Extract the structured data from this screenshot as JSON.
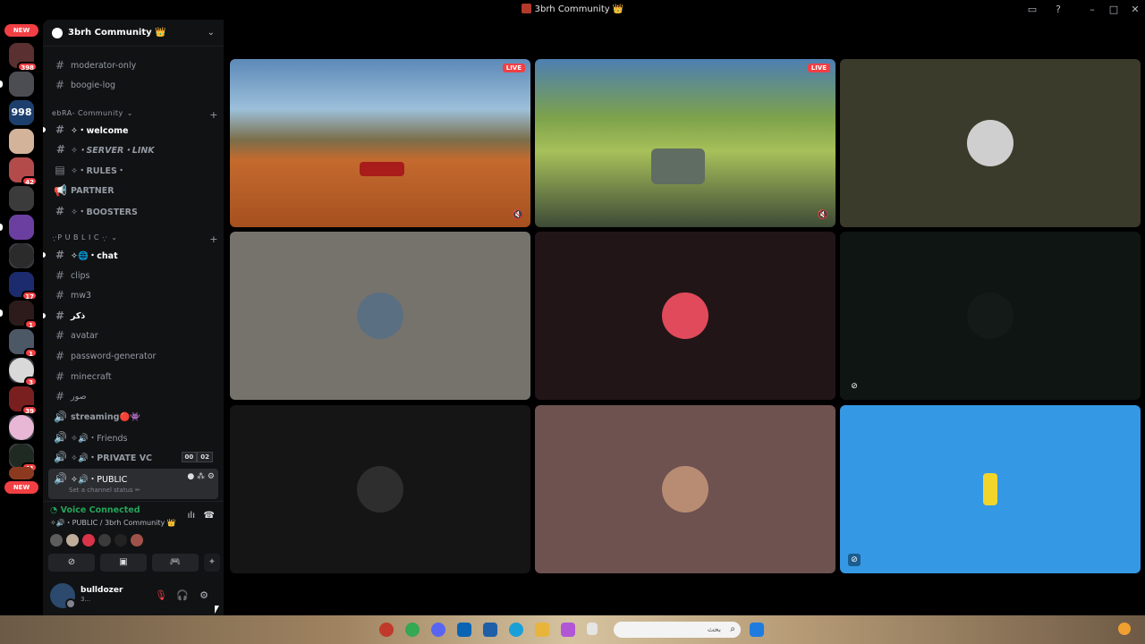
{
  "window": {
    "title": "3brh Community 👑"
  },
  "rail": {
    "new_top": "NEW",
    "new_bottom": "NEW",
    "badges": [
      "398",
      "998",
      "42",
      "17",
      "1",
      "1",
      "3",
      "39",
      "41"
    ]
  },
  "server": {
    "name": "3brh Community 👑"
  },
  "channels": {
    "moderator_only": "moderator-only",
    "boogie_log": "boogie-log",
    "category1": "ebRA- Community",
    "welcome": "✧・welcome",
    "server_link": "✧・SERVER・LINK",
    "rules": "✧・RULES・",
    "partner": "PARTNER",
    "boosters": "✧・BOOSTERS",
    "category2": "·͙·P U B L I C ·͙·",
    "chat": "✧🌐・chat",
    "clips": "clips",
    "mw3": "mw3",
    "dhikr": "ذكر",
    "avatar": "avatar",
    "password_generator": "password-generator",
    "minecraft": "minecraft",
    "suwar": "صور",
    "streaming": "streaming🔴👾",
    "friends": "✧🔊・Friends",
    "private_vc": "✧🔊・PRIVATE VC",
    "private_vc_count_a": "00",
    "private_vc_count_b": "02",
    "public": "✧🔊・PUBLIC",
    "public_status": "Set a channel status ✏"
  },
  "voice": {
    "status": "Voice Connected",
    "location": "✧🔊・PUBLIC / 3brh Community 👑"
  },
  "user": {
    "name": "bulldozer",
    "status": "3..."
  },
  "tiles": {
    "live1": "LIVE",
    "live2": "LIVE"
  },
  "taskbar": {
    "search_placeholder": "بحث"
  },
  "colors": {
    "accent": "#5865f2",
    "online": "#23a55a",
    "danger": "#f23f43"
  }
}
